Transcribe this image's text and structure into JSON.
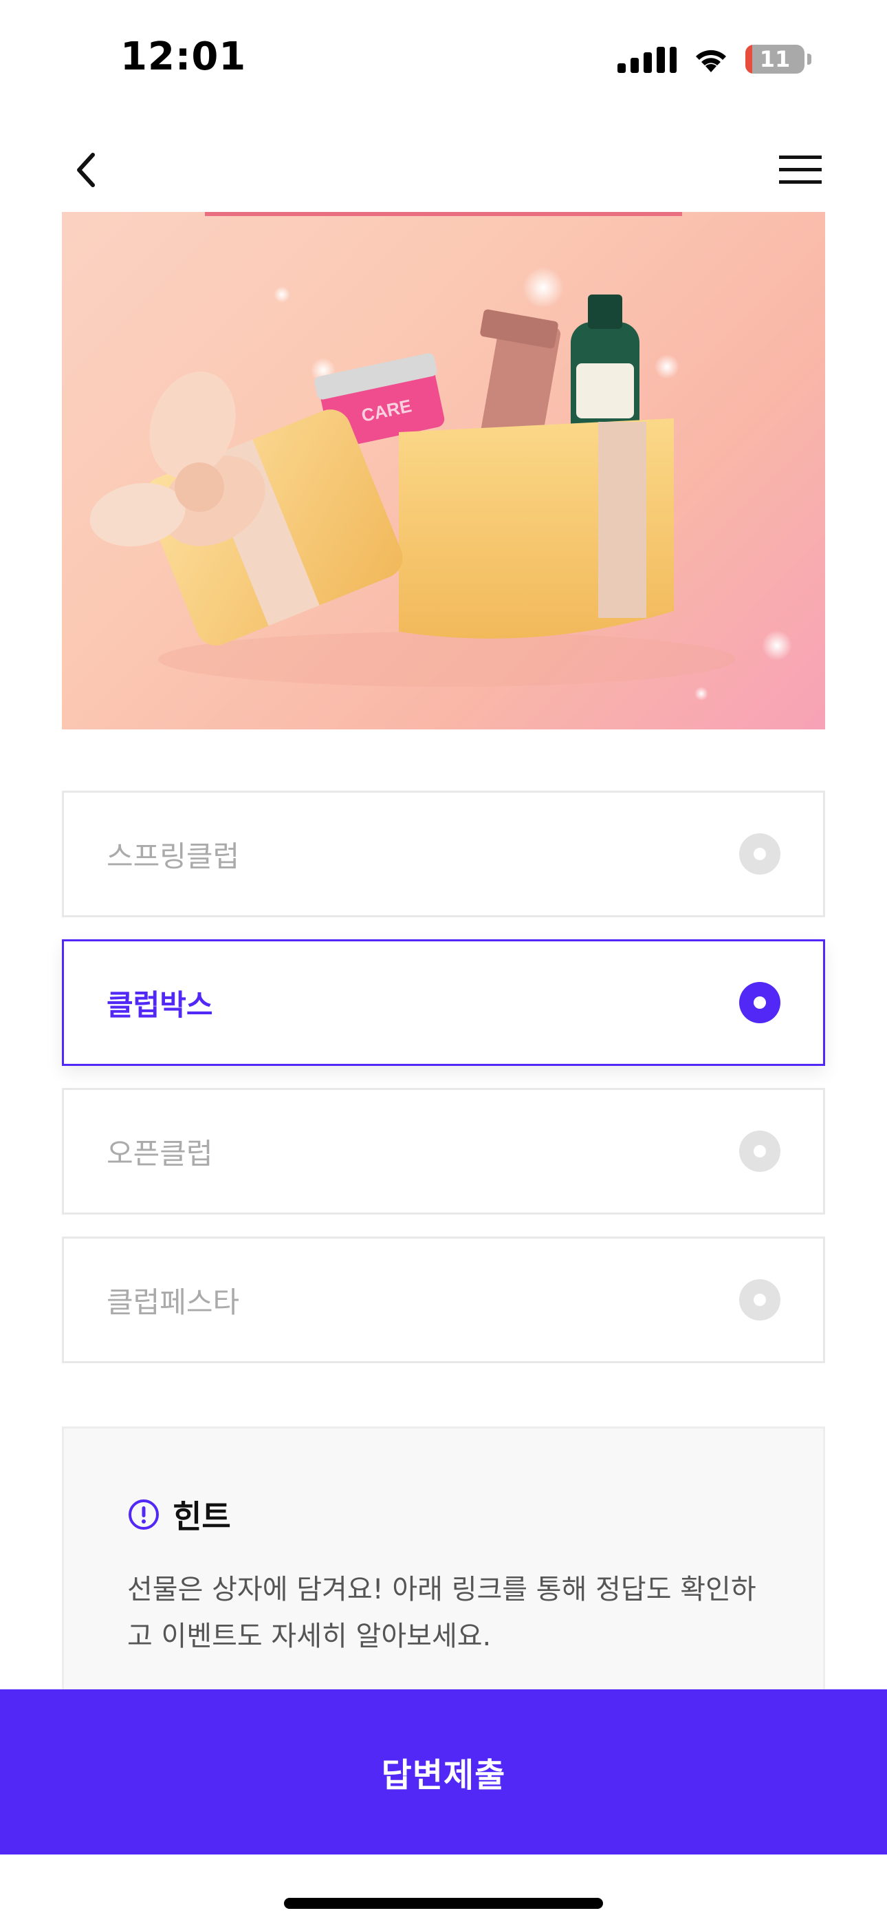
{
  "status_bar": {
    "time": "12:01",
    "battery_level": "11",
    "icons": [
      "signal-icon",
      "wifi-icon",
      "battery-icon"
    ]
  },
  "nav": {
    "back_icon": "chevron-left-icon",
    "menu_icon": "hamburger-menu-icon"
  },
  "hero": {
    "box_label": "CARE"
  },
  "options": [
    {
      "label": "스프링클럽",
      "selected": false
    },
    {
      "label": "클럽박스",
      "selected": true
    },
    {
      "label": "오픈클럽",
      "selected": false
    },
    {
      "label": "클럽페스타",
      "selected": false
    }
  ],
  "hint": {
    "icon": "exclamation-circle-icon",
    "title": "힌트",
    "text": "선물은 상자에 담겨요! 아래 링크를 통해 정답도 확인하고 이벤트도 자세히 알아보세요."
  },
  "submit": {
    "label": "답변제출"
  },
  "colors": {
    "accent": "#5128f5",
    "unselected_text": "#aaaaaa",
    "border": "#e8e8e8"
  }
}
